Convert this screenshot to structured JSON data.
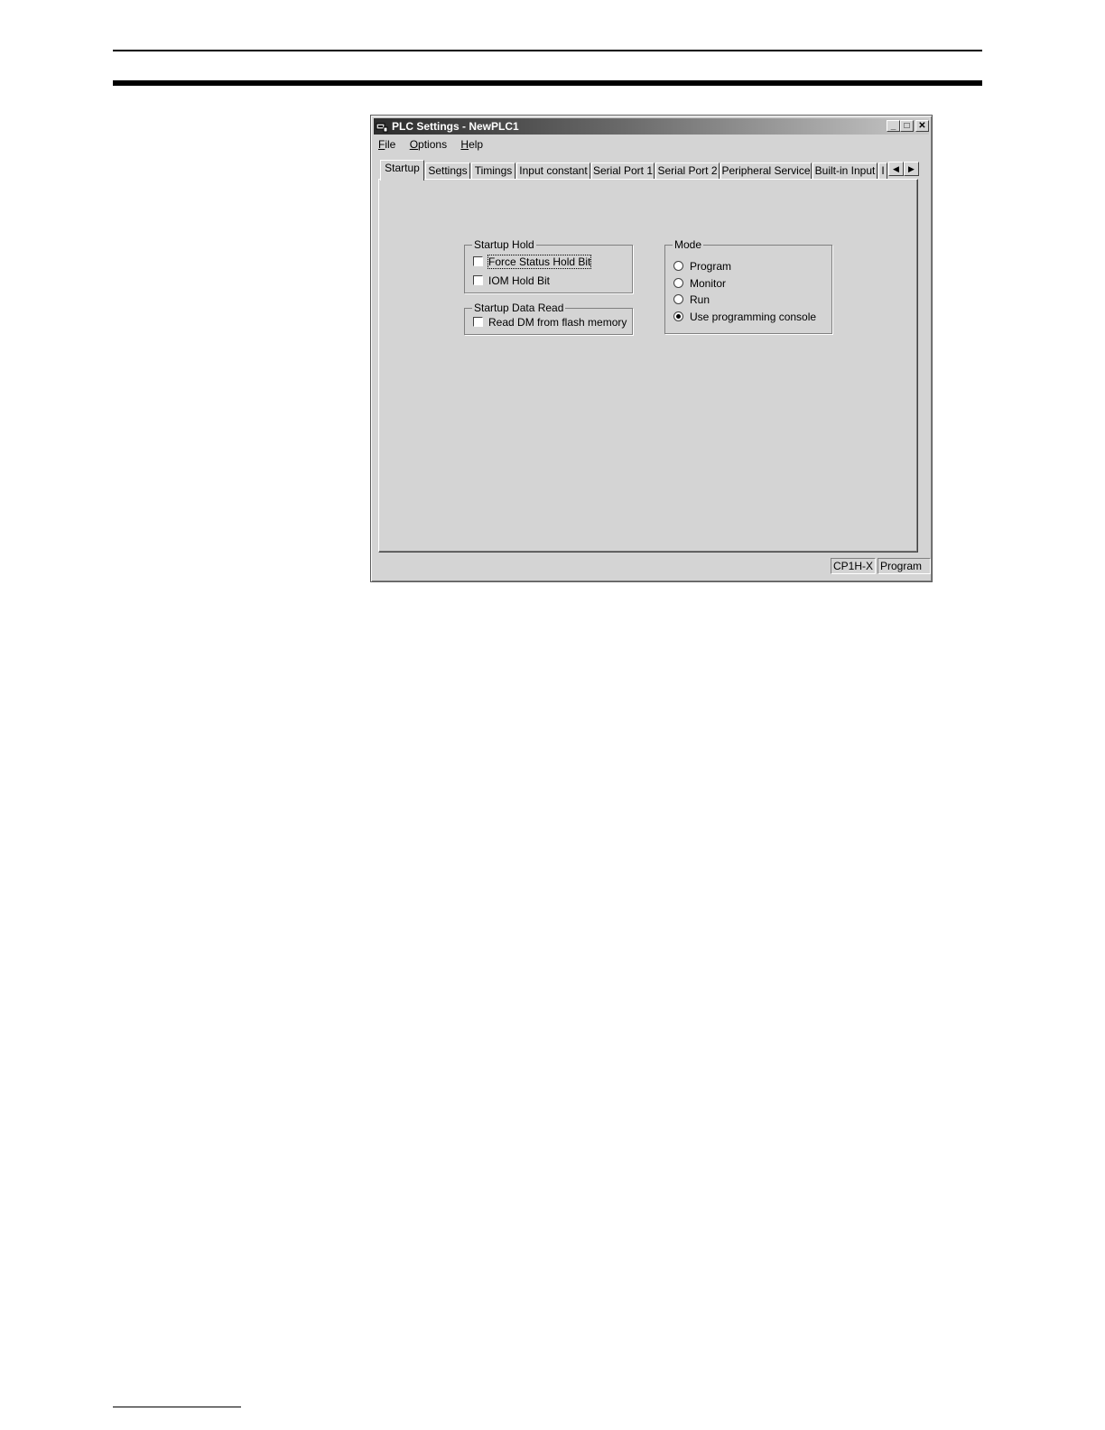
{
  "window": {
    "title": "PLC Settings - NewPLC1",
    "buttons": {
      "minimize": "_",
      "maximize": "□",
      "close": "✕"
    }
  },
  "menu": [
    {
      "label": "File",
      "mnemonic": "F"
    },
    {
      "label": "Options",
      "mnemonic": "O"
    },
    {
      "label": "Help",
      "mnemonic": "H"
    }
  ],
  "tabs": [
    {
      "label": "Startup",
      "active": true
    },
    {
      "label": "Settings"
    },
    {
      "label": "Timings"
    },
    {
      "label": "Input constant"
    },
    {
      "label": "Serial Port 1"
    },
    {
      "label": "Serial Port 2"
    },
    {
      "label": "Peripheral Service"
    },
    {
      "label": "Built-in Input"
    },
    {
      "label": "I"
    }
  ],
  "tab_scroll": {
    "left": "◀",
    "right": "▶"
  },
  "startup_hold": {
    "legend": "Startup Hold",
    "force_status_hold_bit": {
      "label": "Force Status Hold Bit",
      "checked": false
    },
    "iom_hold_bit": {
      "label": "IOM Hold Bit",
      "checked": false
    }
  },
  "startup_data_read": {
    "legend": "Startup Data Read",
    "read_dm": {
      "label": "Read DM from flash memory",
      "checked": false
    }
  },
  "mode": {
    "legend": "Mode",
    "options": [
      {
        "label": "Program",
        "selected": false
      },
      {
        "label": "Monitor",
        "selected": false
      },
      {
        "label": "Run",
        "selected": false
      },
      {
        "label": "Use programming console",
        "selected": true
      }
    ]
  },
  "status": {
    "model": "CP1H-X",
    "mode": "Program"
  },
  "colors": {
    "face": "#d4d4d4",
    "shadow": "#808080",
    "highlight": "#ffffff"
  }
}
